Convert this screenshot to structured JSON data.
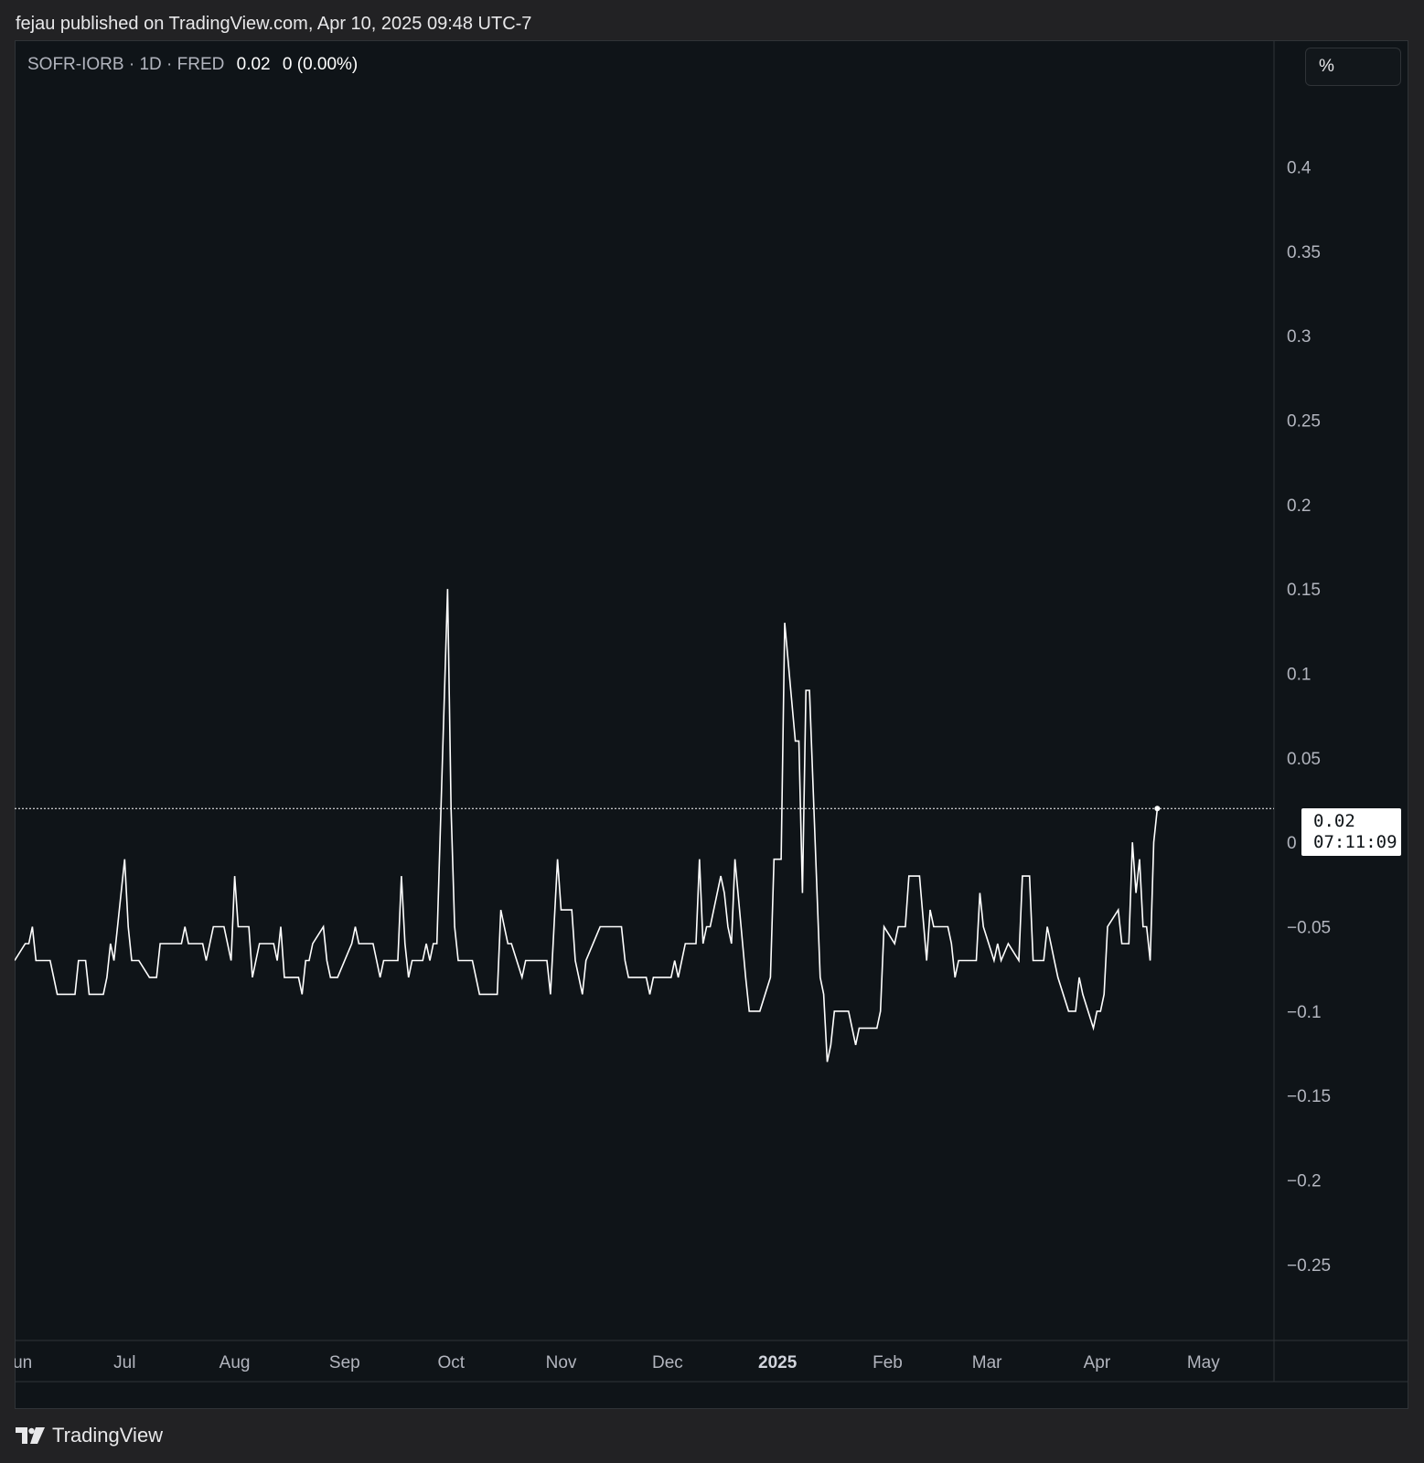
{
  "header": {
    "publisher_text": "fejau published on TradingView.com, Apr 10, 2025 09:48 UTC-7"
  },
  "legend": {
    "symbol": "SOFR-IORB · 1D · FRED",
    "last_value": "0.02",
    "change": "0 (0.00%)"
  },
  "price_scale": {
    "unit_label": "%",
    "last_price_label": "0.02",
    "countdown_label": "07:11:09"
  },
  "footer": {
    "brand_name": "TradingView"
  },
  "colors": {
    "background": "#0f1418",
    "page_background": "#222224",
    "line": "#ffffff",
    "axis_text": "#b2b5be"
  },
  "chart_data": {
    "type": "line",
    "title": "SOFR-IORB · 1D · FRED",
    "x_unit": "date",
    "ylim": [
      -0.295,
      0.475
    ],
    "y_ticks": [
      0.4,
      0.35,
      0.3,
      0.25,
      0.2,
      0.15,
      0.1,
      0.05,
      0,
      -0.05,
      -0.1,
      -0.15,
      -0.2,
      -0.25
    ],
    "y_tick_labels": [
      "0.4",
      "0.35",
      "0.3",
      "0.25",
      "0.2",
      "0.15",
      "0.1",
      "0.05",
      "0",
      "−0.05",
      "−0.1",
      "−0.15",
      "−0.2",
      "−0.25"
    ],
    "x_ticks": [
      {
        "label": "Jun",
        "date": "2024-06-01",
        "bold": false
      },
      {
        "label": "Jul",
        "date": "2024-07-01",
        "bold": false
      },
      {
        "label": "Aug",
        "date": "2024-08-01",
        "bold": false
      },
      {
        "label": "Sep",
        "date": "2024-09-01",
        "bold": false
      },
      {
        "label": "Oct",
        "date": "2024-10-01",
        "bold": false
      },
      {
        "label": "Nov",
        "date": "2024-11-01",
        "bold": false
      },
      {
        "label": "Dec",
        "date": "2024-12-01",
        "bold": false
      },
      {
        "label": "2025",
        "date": "2025-01-01",
        "bold": true
      },
      {
        "label": "Feb",
        "date": "2025-02-01",
        "bold": false
      },
      {
        "label": "Mar",
        "date": "2025-03-01",
        "bold": false
      },
      {
        "label": "Apr",
        "date": "2025-04-01",
        "bold": false
      },
      {
        "label": "May",
        "date": "2025-05-01",
        "bold": false
      }
    ],
    "last_value_line": 0.02,
    "grid": false,
    "series": [
      {
        "points": [
          [
            "2024-05-31",
            -0.07
          ],
          [
            "2024-06-03",
            -0.06
          ],
          [
            "2024-06-04",
            -0.06
          ],
          [
            "2024-06-05",
            -0.05
          ],
          [
            "2024-06-06",
            -0.07
          ],
          [
            "2024-06-10",
            -0.07
          ],
          [
            "2024-06-11",
            -0.08
          ],
          [
            "2024-06-12",
            -0.09
          ],
          [
            "2024-06-17",
            -0.09
          ],
          [
            "2024-06-18",
            -0.07
          ],
          [
            "2024-06-20",
            -0.07
          ],
          [
            "2024-06-21",
            -0.09
          ],
          [
            "2024-06-25",
            -0.09
          ],
          [
            "2024-06-26",
            -0.08
          ],
          [
            "2024-06-27",
            -0.06
          ],
          [
            "2024-06-28",
            -0.07
          ],
          [
            "2024-07-01",
            -0.01
          ],
          [
            "2024-07-02",
            -0.05
          ],
          [
            "2024-07-03",
            -0.07
          ],
          [
            "2024-07-05",
            -0.07
          ],
          [
            "2024-07-08",
            -0.08
          ],
          [
            "2024-07-10",
            -0.08
          ],
          [
            "2024-07-11",
            -0.06
          ],
          [
            "2024-07-15",
            -0.06
          ],
          [
            "2024-07-17",
            -0.06
          ],
          [
            "2024-07-18",
            -0.05
          ],
          [
            "2024-07-19",
            -0.06
          ],
          [
            "2024-07-22",
            -0.06
          ],
          [
            "2024-07-23",
            -0.06
          ],
          [
            "2024-07-24",
            -0.07
          ],
          [
            "2024-07-25",
            -0.06
          ],
          [
            "2024-07-26",
            -0.05
          ],
          [
            "2024-07-29",
            -0.05
          ],
          [
            "2024-07-30",
            -0.06
          ],
          [
            "2024-07-31",
            -0.07
          ],
          [
            "2024-08-01",
            -0.02
          ],
          [
            "2024-08-02",
            -0.05
          ],
          [
            "2024-08-05",
            -0.05
          ],
          [
            "2024-08-06",
            -0.08
          ],
          [
            "2024-08-07",
            -0.07
          ],
          [
            "2024-08-08",
            -0.06
          ],
          [
            "2024-08-12",
            -0.06
          ],
          [
            "2024-08-13",
            -0.07
          ],
          [
            "2024-08-14",
            -0.05
          ],
          [
            "2024-08-15",
            -0.08
          ],
          [
            "2024-08-19",
            -0.08
          ],
          [
            "2024-08-20",
            -0.09
          ],
          [
            "2024-08-21",
            -0.07
          ],
          [
            "2024-08-22",
            -0.07
          ],
          [
            "2024-08-23",
            -0.06
          ],
          [
            "2024-08-26",
            -0.05
          ],
          [
            "2024-08-27",
            -0.07
          ],
          [
            "2024-08-28",
            -0.08
          ],
          [
            "2024-08-30",
            -0.08
          ],
          [
            "2024-09-03",
            -0.06
          ],
          [
            "2024-09-04",
            -0.05
          ],
          [
            "2024-09-05",
            -0.06
          ],
          [
            "2024-09-09",
            -0.06
          ],
          [
            "2024-09-10",
            -0.07
          ],
          [
            "2024-09-11",
            -0.08
          ],
          [
            "2024-09-12",
            -0.07
          ],
          [
            "2024-09-16",
            -0.07
          ],
          [
            "2024-09-17",
            -0.02
          ],
          [
            "2024-09-18",
            -0.06
          ],
          [
            "2024-09-19",
            -0.08
          ],
          [
            "2024-09-20",
            -0.07
          ],
          [
            "2024-09-23",
            -0.07
          ],
          [
            "2024-09-24",
            -0.06
          ],
          [
            "2024-09-25",
            -0.07
          ],
          [
            "2024-09-26",
            -0.06
          ],
          [
            "2024-09-27",
            -0.06
          ],
          [
            "2024-09-30",
            0.15
          ],
          [
            "2024-10-01",
            0.02
          ],
          [
            "2024-10-02",
            -0.05
          ],
          [
            "2024-10-03",
            -0.07
          ],
          [
            "2024-10-07",
            -0.07
          ],
          [
            "2024-10-09",
            -0.09
          ],
          [
            "2024-10-14",
            -0.09
          ],
          [
            "2024-10-15",
            -0.04
          ],
          [
            "2024-10-16",
            -0.05
          ],
          [
            "2024-10-17",
            -0.06
          ],
          [
            "2024-10-18",
            -0.06
          ],
          [
            "2024-10-21",
            -0.08
          ],
          [
            "2024-10-22",
            -0.07
          ],
          [
            "2024-10-28",
            -0.07
          ],
          [
            "2024-10-29",
            -0.09
          ],
          [
            "2024-10-31",
            -0.01
          ],
          [
            "2024-11-01",
            -0.04
          ],
          [
            "2024-11-04",
            -0.04
          ],
          [
            "2024-11-05",
            -0.07
          ],
          [
            "2024-11-07",
            -0.09
          ],
          [
            "2024-11-08",
            -0.07
          ],
          [
            "2024-11-12",
            -0.05
          ],
          [
            "2024-11-18",
            -0.05
          ],
          [
            "2024-11-19",
            -0.07
          ],
          [
            "2024-11-20",
            -0.08
          ],
          [
            "2024-11-25",
            -0.08
          ],
          [
            "2024-11-26",
            -0.09
          ],
          [
            "2024-11-27",
            -0.08
          ],
          [
            "2024-12-02",
            -0.08
          ],
          [
            "2024-12-03",
            -0.07
          ],
          [
            "2024-12-04",
            -0.08
          ],
          [
            "2024-12-06",
            -0.06
          ],
          [
            "2024-12-09",
            -0.06
          ],
          [
            "2024-12-10",
            -0.01
          ],
          [
            "2024-12-11",
            -0.06
          ],
          [
            "2024-12-12",
            -0.05
          ],
          [
            "2024-12-13",
            -0.05
          ],
          [
            "2024-12-16",
            -0.02
          ],
          [
            "2024-12-17",
            -0.03
          ],
          [
            "2024-12-18",
            -0.05
          ],
          [
            "2024-12-19",
            -0.06
          ],
          [
            "2024-12-20",
            -0.01
          ],
          [
            "2024-12-23",
            -0.08
          ],
          [
            "2024-12-24",
            -0.1
          ],
          [
            "2024-12-27",
            -0.1
          ],
          [
            "2024-12-30",
            -0.08
          ],
          [
            "2024-12-31",
            -0.01
          ],
          [
            "2025-01-02",
            -0.01
          ],
          [
            "2025-01-03",
            0.13
          ],
          [
            "2025-01-06",
            0.06
          ],
          [
            "2025-01-07",
            0.06
          ],
          [
            "2025-01-08",
            -0.03
          ],
          [
            "2025-01-09",
            0.09
          ],
          [
            "2025-01-10",
            0.09
          ],
          [
            "2025-01-13",
            -0.08
          ],
          [
            "2025-01-14",
            -0.09
          ],
          [
            "2025-01-15",
            -0.13
          ],
          [
            "2025-01-16",
            -0.12
          ],
          [
            "2025-01-17",
            -0.1
          ],
          [
            "2025-01-21",
            -0.1
          ],
          [
            "2025-01-22",
            -0.11
          ],
          [
            "2025-01-23",
            -0.12
          ],
          [
            "2025-01-24",
            -0.11
          ],
          [
            "2025-01-29",
            -0.11
          ],
          [
            "2025-01-30",
            -0.1
          ],
          [
            "2025-01-31",
            -0.05
          ],
          [
            "2025-02-03",
            -0.06
          ],
          [
            "2025-02-04",
            -0.05
          ],
          [
            "2025-02-06",
            -0.05
          ],
          [
            "2025-02-07",
            -0.02
          ],
          [
            "2025-02-10",
            -0.02
          ],
          [
            "2025-02-12",
            -0.07
          ],
          [
            "2025-02-13",
            -0.04
          ],
          [
            "2025-02-14",
            -0.05
          ],
          [
            "2025-02-18",
            -0.05
          ],
          [
            "2025-02-19",
            -0.06
          ],
          [
            "2025-02-20",
            -0.08
          ],
          [
            "2025-02-21",
            -0.07
          ],
          [
            "2025-02-26",
            -0.07
          ],
          [
            "2025-02-27",
            -0.03
          ],
          [
            "2025-02-28",
            -0.05
          ],
          [
            "2025-03-03",
            -0.07
          ],
          [
            "2025-03-04",
            -0.06
          ],
          [
            "2025-03-05",
            -0.07
          ],
          [
            "2025-03-07",
            -0.06
          ],
          [
            "2025-03-10",
            -0.07
          ],
          [
            "2025-03-11",
            -0.02
          ],
          [
            "2025-03-13",
            -0.02
          ],
          [
            "2025-03-14",
            -0.07
          ],
          [
            "2025-03-17",
            -0.07
          ],
          [
            "2025-03-18",
            -0.05
          ],
          [
            "2025-03-19",
            -0.06
          ],
          [
            "2025-03-20",
            -0.07
          ],
          [
            "2025-03-21",
            -0.08
          ],
          [
            "2025-03-24",
            -0.1
          ],
          [
            "2025-03-26",
            -0.1
          ],
          [
            "2025-03-27",
            -0.08
          ],
          [
            "2025-03-28",
            -0.09
          ],
          [
            "2025-03-31",
            -0.11
          ],
          [
            "2025-04-01",
            -0.1
          ],
          [
            "2025-04-02",
            -0.1
          ],
          [
            "2025-04-03",
            -0.09
          ],
          [
            "2025-04-04",
            -0.05
          ],
          [
            "2025-04-07",
            -0.04
          ],
          [
            "2025-04-08",
            -0.06
          ],
          [
            "2025-04-10",
            -0.06
          ],
          [
            "2025-04-11",
            0.0
          ],
          [
            "2025-04-12",
            -0.03
          ],
          [
            "2025-04-13",
            -0.01
          ],
          [
            "2025-04-14",
            -0.05
          ],
          [
            "2025-04-15",
            -0.05
          ],
          [
            "2025-04-16",
            -0.07
          ],
          [
            "2025-04-17",
            0.0
          ],
          [
            "2025-04-18",
            0.02
          ]
        ]
      }
    ]
  }
}
